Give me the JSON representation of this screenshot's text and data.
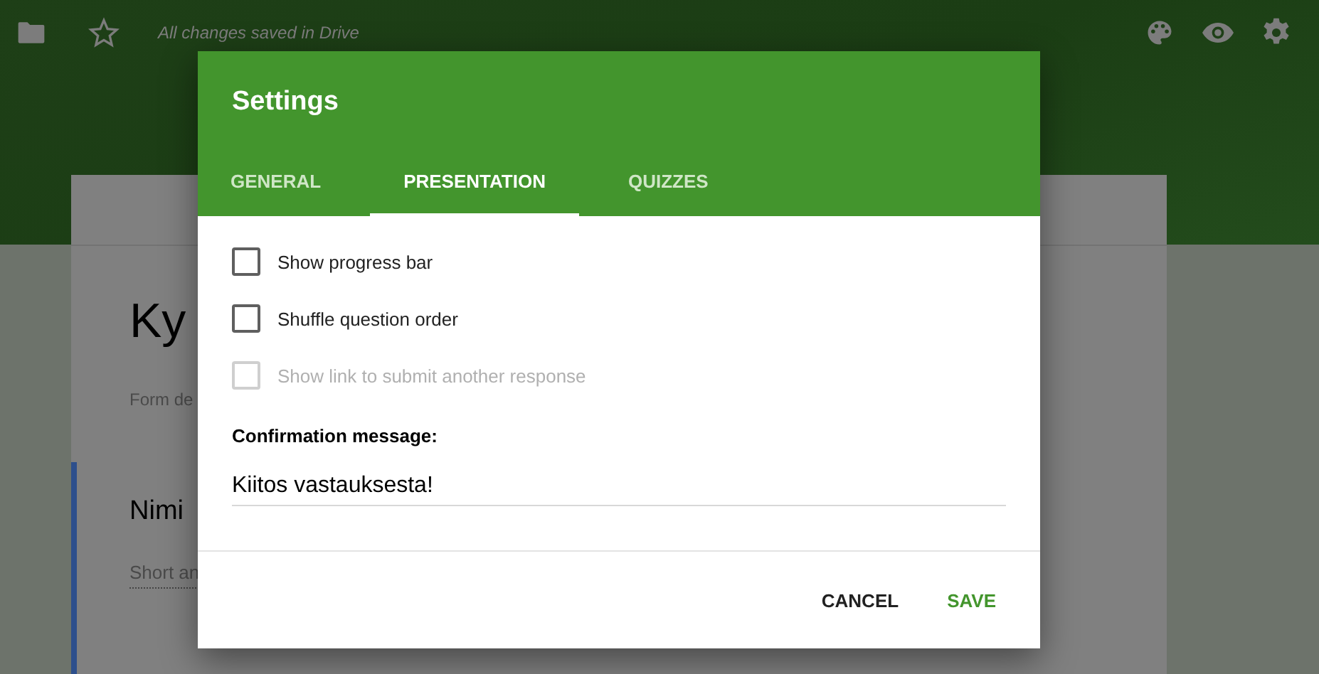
{
  "toolbar": {
    "status": "All changes saved in Drive"
  },
  "form": {
    "title": "Ky",
    "description": "Form de",
    "question": {
      "title": "Nimi",
      "placeholder": "Short an"
    }
  },
  "dialog": {
    "title": "Settings",
    "tabs": [
      {
        "label": "GENERAL",
        "selected": false
      },
      {
        "label": "PRESENTATION",
        "selected": true
      },
      {
        "label": "QUIZZES",
        "selected": false
      }
    ],
    "options": [
      {
        "label": "Show progress bar",
        "checked": false,
        "disabled": false
      },
      {
        "label": "Shuffle question order",
        "checked": false,
        "disabled": false
      },
      {
        "label": "Show link to submit another response",
        "checked": false,
        "disabled": true
      }
    ],
    "confirmation": {
      "label": "Confirmation message:",
      "value": "Kiitos vastauksesta!"
    },
    "buttons": [
      {
        "label": "CANCEL",
        "kind": "secondary"
      },
      {
        "label": "SAVE",
        "kind": "primary"
      }
    ]
  }
}
